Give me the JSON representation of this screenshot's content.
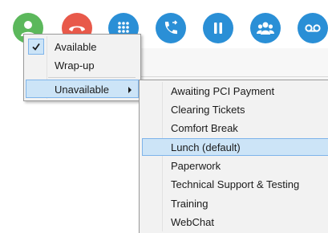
{
  "toolbar": {
    "buttons": [
      {
        "name": "status-person-icon",
        "color": "#5cb85c"
      },
      {
        "name": "hangup-phone-icon",
        "color": "#e8594a"
      },
      {
        "name": "dialpad-icon",
        "color": "#2a8fd6"
      },
      {
        "name": "transfer-call-icon",
        "color": "#2a8fd6"
      },
      {
        "name": "hold-pause-icon",
        "color": "#2a8fd6"
      },
      {
        "name": "conference-group-icon",
        "color": "#2a8fd6"
      },
      {
        "name": "voicemail-icon",
        "color": "#2a8fd6"
      }
    ]
  },
  "status_menu": {
    "items": [
      {
        "label": "Available",
        "checked": true
      },
      {
        "label": "Wrap-up"
      },
      {
        "label": "Unavailable",
        "has_submenu": true,
        "highlighted": true
      }
    ]
  },
  "unavailable_submenu": {
    "items": [
      {
        "label": "Awaiting PCI Payment"
      },
      {
        "label": "Clearing Tickets"
      },
      {
        "label": "Comfort Break"
      },
      {
        "label": "Lunch (default)",
        "highlighted": true
      },
      {
        "label": "Paperwork"
      },
      {
        "label": "Technical Support & Testing"
      },
      {
        "label": "Training"
      },
      {
        "label": "WebChat"
      }
    ]
  },
  "colors": {
    "accent_blue": "#2a8fd6",
    "status_green": "#5cb85c",
    "hangup_red": "#e8594a",
    "menu_highlight": "#cce4f7",
    "menu_highlight_border": "#7eb4ea"
  }
}
